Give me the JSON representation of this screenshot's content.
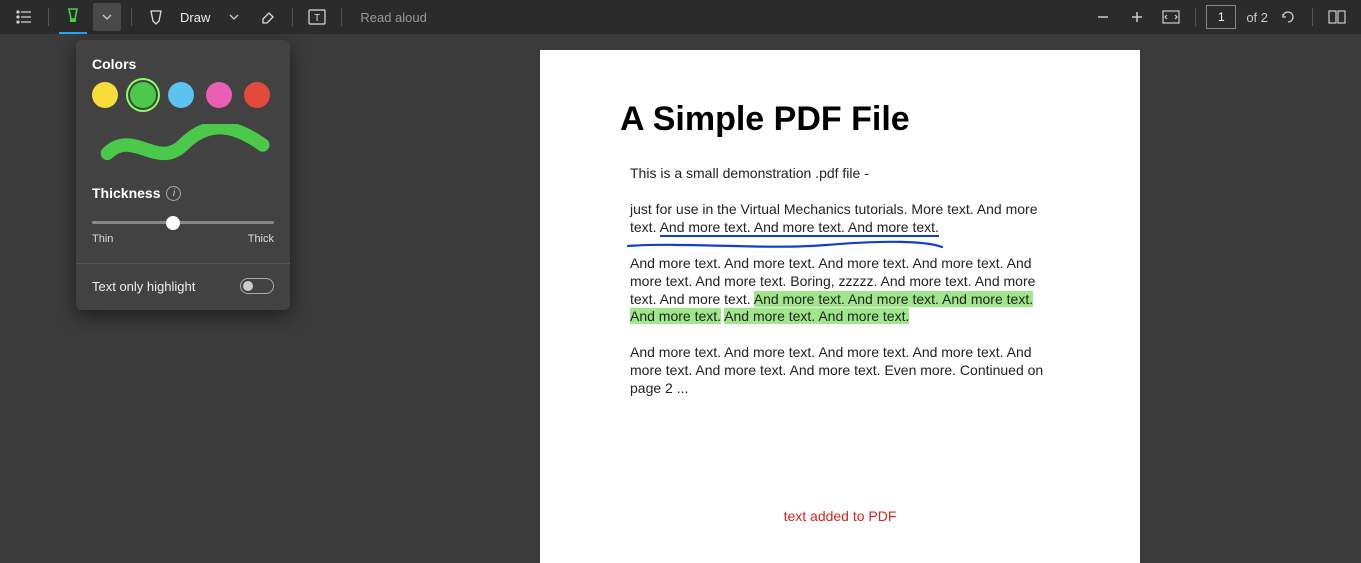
{
  "toolbar": {
    "draw_label": "Draw",
    "read_aloud_label": "Read aloud",
    "page_current": "1",
    "page_total": "of 2"
  },
  "popup": {
    "colors_title": "Colors",
    "colors": [
      {
        "name": "yellow",
        "hex": "#f7dc3a",
        "selected": false
      },
      {
        "name": "green",
        "hex": "#4ac94a",
        "selected": true
      },
      {
        "name": "blue",
        "hex": "#5cc3f0",
        "selected": false
      },
      {
        "name": "pink",
        "hex": "#ea5eb4",
        "selected": false
      },
      {
        "name": "red",
        "hex": "#e44a3c",
        "selected": false
      }
    ],
    "thickness_title": "Thickness",
    "slider_min_label": "Thin",
    "slider_max_label": "Thick",
    "slider_value": 44,
    "toggle_label": "Text only highlight",
    "toggle_on": false
  },
  "pdf": {
    "title": "A Simple PDF File",
    "p1": "This is a small demonstration .pdf file -",
    "p2_pre": "just for use in the Virtual Mechanics tutorials. More text. And more text. ",
    "p2_under": "And more text. And more text. And more text.",
    "p3_pre": "And more text. And more text. And more text. And more text. And more text. And more text. Boring, zzzzz. And more text. And more text. And more text. ",
    "p3_hl1": "And more text. And more text. And more text. And more text.",
    "p3_hl2": "And more text. And more text.",
    "p4": "And more text. And more text. And more text. And more text. And more text. And more text. And more text. Even more. Continued on page 2 ...",
    "added_text": "text added to PDF"
  }
}
